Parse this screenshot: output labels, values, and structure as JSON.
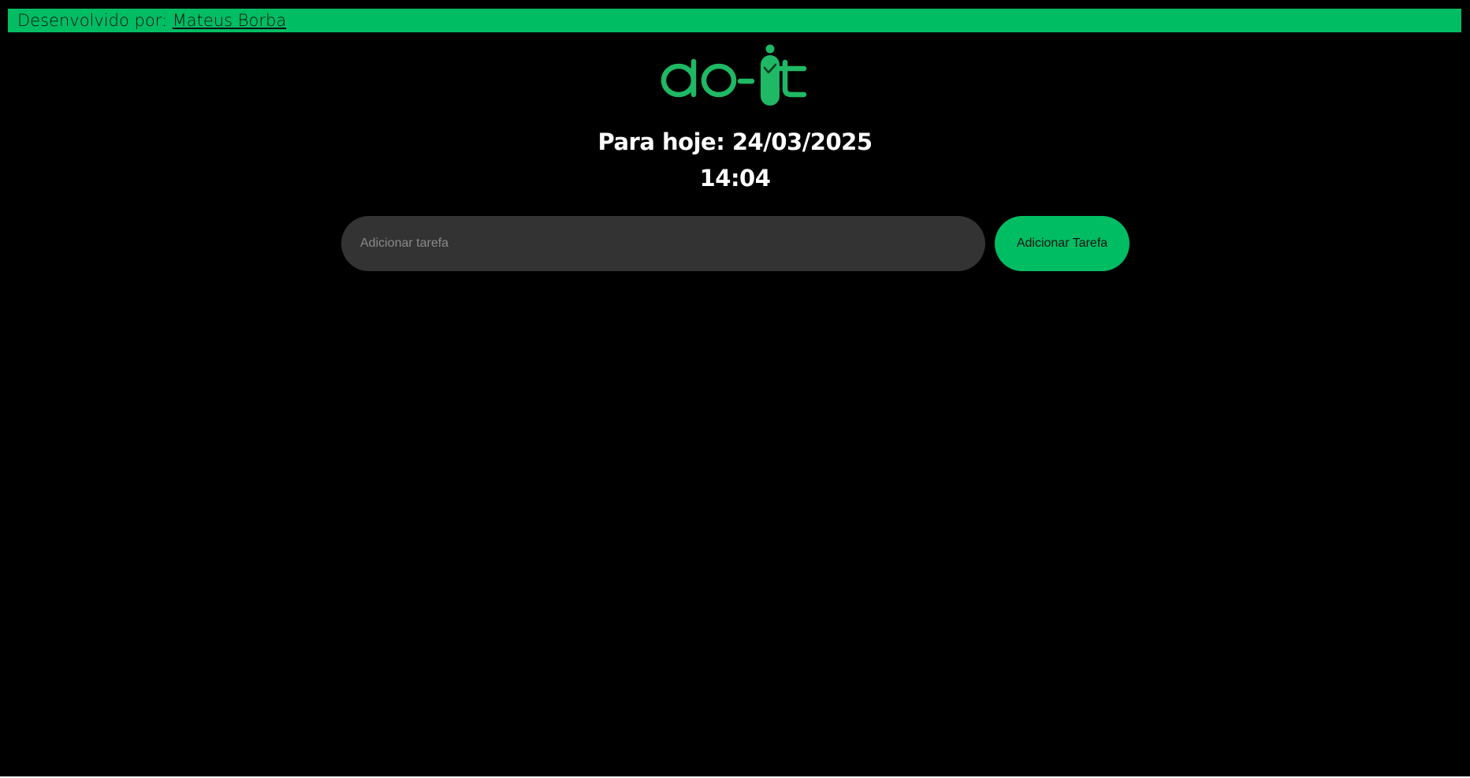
{
  "footer_bar": {
    "prefix": "Desenvolvido por: ",
    "author_link": "Mateus Borba"
  },
  "logo": {
    "text": "do-it",
    "color": "#1fb864"
  },
  "header": {
    "date_line": "Para hoje: 24/03/2025",
    "time_line": "14:04"
  },
  "task_form": {
    "input_value": "",
    "input_placeholder": "Adicionar tarefa",
    "submit_label": "Adicionar Tarefa"
  },
  "colors": {
    "background": "#000000",
    "accent": "#00bd63",
    "input_background": "#333333"
  }
}
